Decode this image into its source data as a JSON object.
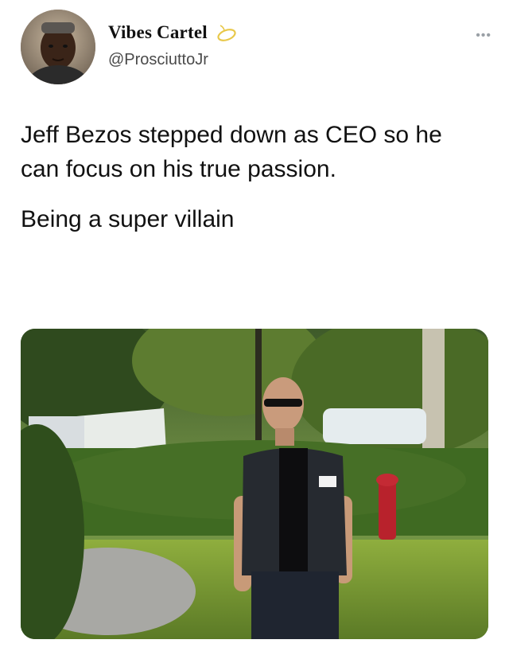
{
  "user": {
    "display_name": "Vibes Cartel",
    "handle": "@ProsciuttoJr"
  },
  "menu_icon": "more-dots-icon",
  "badge_icon": "halo-icon",
  "tweet": {
    "paragraphs": [
      "Jeff Bezos stepped down as CEO so he can focus on his true passion.",
      "Being a super villain"
    ]
  },
  "media": {
    "description_icon": "photo"
  }
}
